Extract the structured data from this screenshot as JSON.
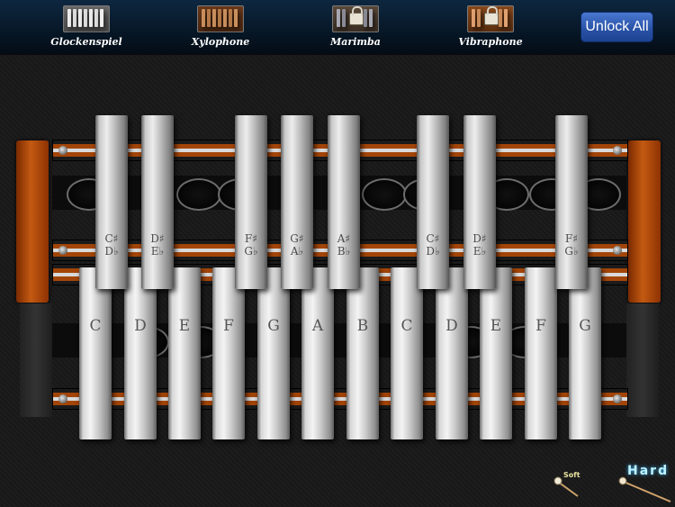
{
  "toolbar": {
    "instruments": [
      {
        "label": "Glockenspiel",
        "icon": "glockenspiel-icon",
        "locked": false
      },
      {
        "label": "Xylophone",
        "icon": "xylophone-icon",
        "locked": false
      },
      {
        "label": "Marimba",
        "icon": "marimba-icon",
        "locked": true
      },
      {
        "label": "Vibraphone",
        "icon": "vibraphone-icon",
        "locked": true
      }
    ],
    "unlock_label": "Unlock All"
  },
  "natural_bars": [
    "C",
    "D",
    "E",
    "F",
    "G",
    "A",
    "B",
    "C",
    "D",
    "E",
    "F",
    "G"
  ],
  "sharp_bars": [
    {
      "top": "C♯",
      "bottom": "D♭"
    },
    {
      "top": "D♯",
      "bottom": "E♭"
    },
    {
      "top": "F♯",
      "bottom": "G♭"
    },
    {
      "top": "G♯",
      "bottom": "A♭"
    },
    {
      "top": "A♯",
      "bottom": "B♭"
    },
    {
      "top": "C♯",
      "bottom": "D♭"
    },
    {
      "top": "D♯",
      "bottom": "E♭"
    },
    {
      "top": "F♯",
      "bottom": "G♭"
    }
  ],
  "mallets": {
    "soft_label": "Soft",
    "hard_label": "Hard"
  },
  "colors": {
    "toolbar_bg": "#071726",
    "button_blue": "#2a53a8",
    "frame_orange": "#c45a12",
    "hard_label_color": "#bff3ff"
  }
}
